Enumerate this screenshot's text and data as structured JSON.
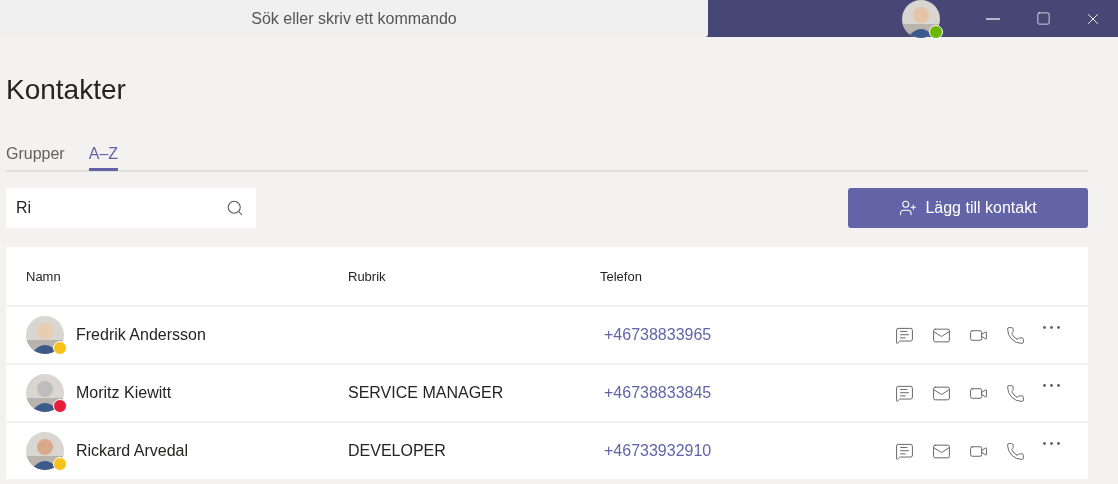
{
  "title_bar": {
    "search": {
      "placeholder": "Sök eller skriv ett kommando"
    },
    "user": {
      "available": true
    }
  },
  "page": {
    "title": "Kontakter"
  },
  "tabs": [
    {
      "label": "Grupper",
      "selected": false
    },
    {
      "label": "A–Z",
      "selected": true
    }
  ],
  "search": {
    "value": "Ri"
  },
  "add_button": {
    "label": "Lägg till kontakt"
  },
  "table": {
    "columns": [
      "Namn",
      "Rubrik",
      "Telefon"
    ],
    "rows": [
      {
        "name": "Fredrik Andersson",
        "phone": "+46738833965",
        "color": "#f8c21b"
      },
      {
        "name": "Moritz Kiewitt",
        "title": "SERVICE MANAGER",
        "phone": "+46738833845",
        "color": "#e81e3b"
      },
      {
        "name": "Rickard Arvedal",
        "title": "DEVELOPER",
        "phone": "+46733932910",
        "color": "#f8c21b"
      }
    ]
  }
}
